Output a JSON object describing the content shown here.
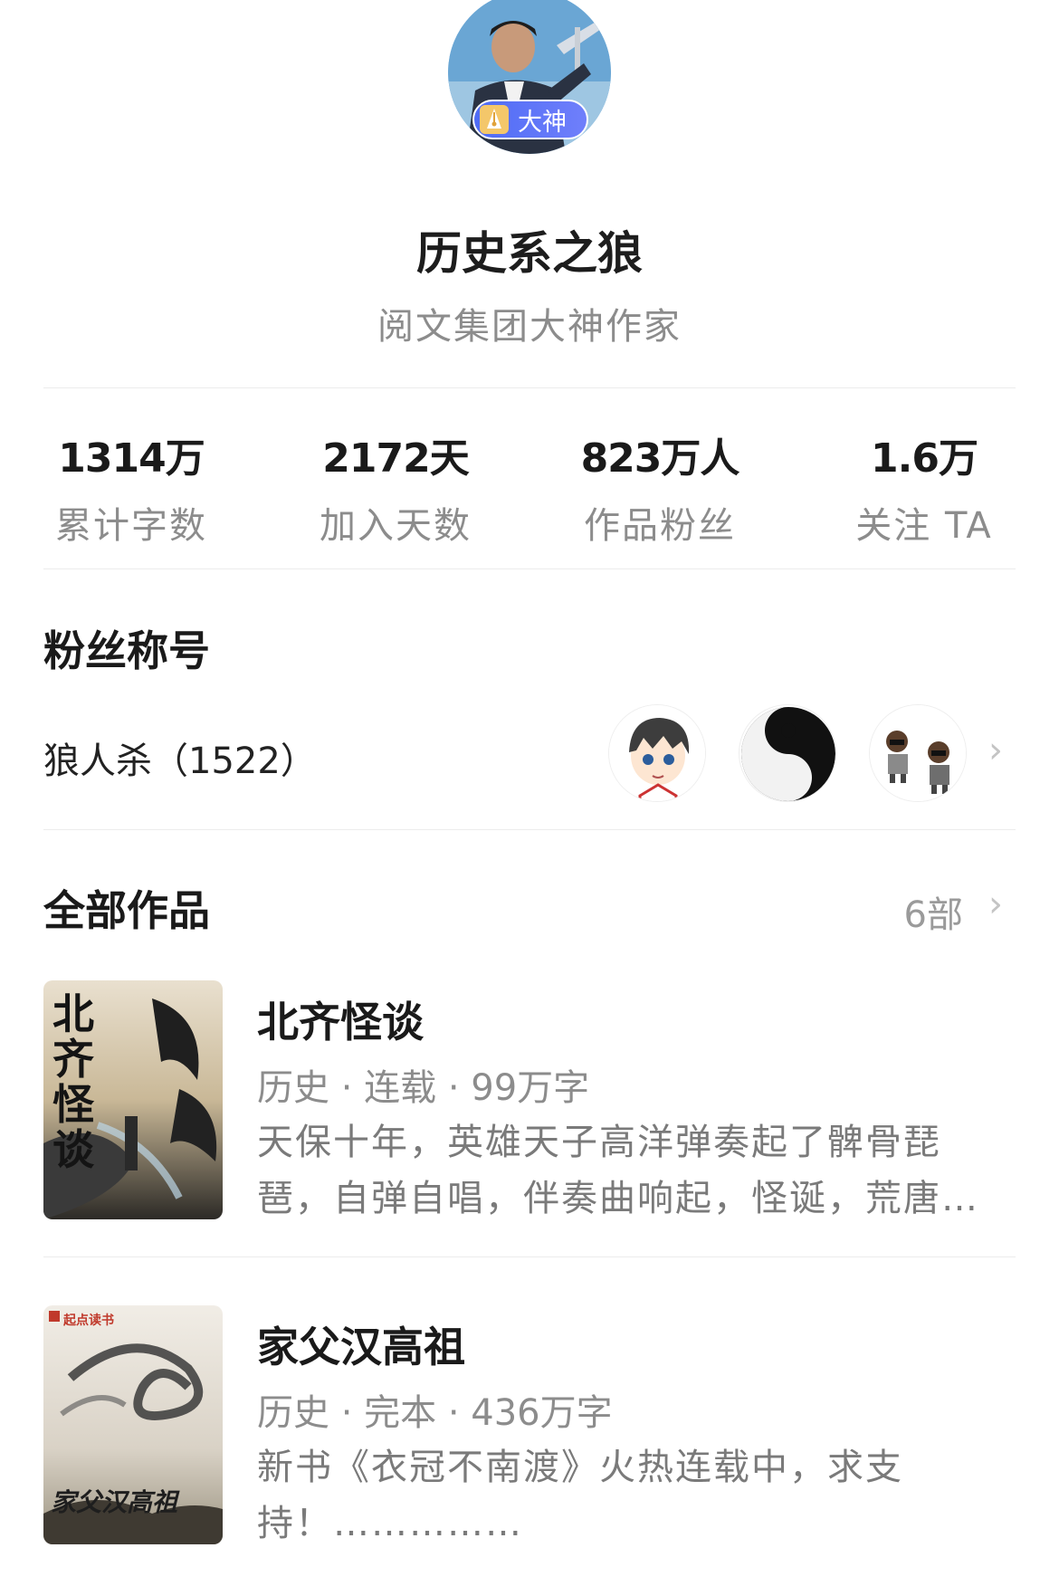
{
  "author": {
    "badge_label": "大神",
    "name": "历史系之狼",
    "subtitle": "阅文集团大神作家"
  },
  "stats": [
    {
      "value": "1314万",
      "label": "累计字数"
    },
    {
      "value": "2172天",
      "label": "加入天数"
    },
    {
      "value": "823万人",
      "label": "作品粉丝"
    },
    {
      "value": "1.6万",
      "label": "关注 TA"
    }
  ],
  "fan_section": {
    "title": "粉丝称号",
    "fan_title": "狼人杀（1522）"
  },
  "works_section": {
    "title": "全部作品",
    "count": "6部"
  },
  "works": [
    {
      "title": "北齐怪谈",
      "meta": "历史 · 连载 · 99万字",
      "description": "天保十年，英雄天子高洋弹奏起了髀骨琵琶，自弹自唱，伴奏曲响起，怪诞，荒唐，血腥，恐怖……",
      "cover_text": "北齐怪谈"
    },
    {
      "title": "家父汉高祖",
      "meta": "历史 · 完本 · 436万字",
      "description": "新书《衣冠不南渡》火热连载中，求支持！……………",
      "cover_text": "家父汉高祖",
      "cover_brand": "起点读书"
    }
  ],
  "colors": {
    "badge": "#5b73f7",
    "muted_text": "#8c8c8c",
    "divider": "#ececec"
  }
}
